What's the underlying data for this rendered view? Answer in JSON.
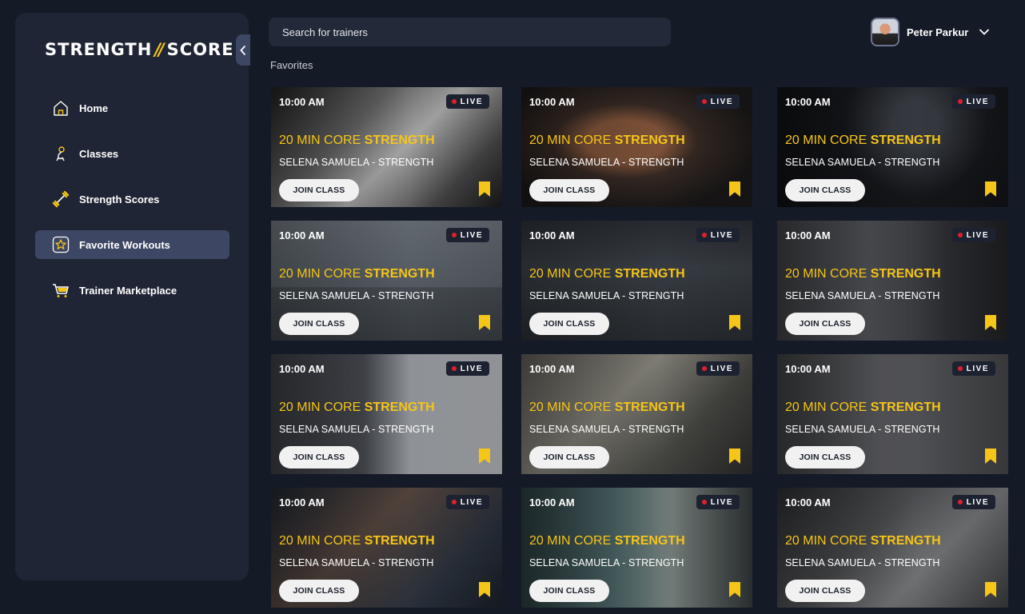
{
  "app": {
    "logo_left": "STRENGTH",
    "logo_slash": "//",
    "logo_right": "SCORE"
  },
  "sidebar": {
    "items": [
      {
        "label": "Home",
        "icon": "home-icon",
        "active": false
      },
      {
        "label": "Classes",
        "icon": "classes-icon",
        "active": false
      },
      {
        "label": "Strength Scores",
        "icon": "dumbbell-icon",
        "active": false
      },
      {
        "label": "Favorite Workouts",
        "icon": "star-icon",
        "active": true
      },
      {
        "label": "Trainer Marketplace",
        "icon": "cart-icon",
        "active": false
      }
    ]
  },
  "header": {
    "search_placeholder": "Search for trainers",
    "user_name": "Peter Parkur"
  },
  "main": {
    "section_title": "Favorites",
    "cards": [
      {
        "time": "10:00 AM",
        "live": "LIVE",
        "title_plain": "20 MIN CORE ",
        "title_bold": "STRENGTH",
        "subtitle": "SELENA SAMUELA - STRENGTH",
        "join_label": "JOIN CLASS"
      },
      {
        "time": "10:00 AM",
        "live": "LIVE",
        "title_plain": "20 MIN CORE ",
        "title_bold": "STRENGTH",
        "subtitle": "SELENA SAMUELA - STRENGTH",
        "join_label": "JOIN CLASS"
      },
      {
        "time": "10:00 AM",
        "live": "LIVE",
        "title_plain": "20 MIN CORE ",
        "title_bold": "STRENGTH",
        "subtitle": "SELENA SAMUELA - STRENGTH",
        "join_label": "JOIN CLASS"
      },
      {
        "time": "10:00 AM",
        "live": "LIVE",
        "title_plain": "20 MIN CORE ",
        "title_bold": "STRENGTH",
        "subtitle": "SELENA SAMUELA - STRENGTH",
        "join_label": "JOIN CLASS"
      },
      {
        "time": "10:00 AM",
        "live": "LIVE",
        "title_plain": "20 MIN CORE ",
        "title_bold": "STRENGTH",
        "subtitle": "SELENA SAMUELA - STRENGTH",
        "join_label": "JOIN CLASS"
      },
      {
        "time": "10:00 AM",
        "live": "LIVE",
        "title_plain": "20 MIN CORE ",
        "title_bold": "STRENGTH",
        "subtitle": "SELENA SAMUELA - STRENGTH",
        "join_label": "JOIN CLASS"
      },
      {
        "time": "10:00 AM",
        "live": "LIVE",
        "title_plain": "20 MIN CORE ",
        "title_bold": "STRENGTH",
        "subtitle": "SELENA SAMUELA - STRENGTH",
        "join_label": "JOIN CLASS"
      },
      {
        "time": "10:00 AM",
        "live": "LIVE",
        "title_plain": "20 MIN CORE ",
        "title_bold": "STRENGTH",
        "subtitle": "SELENA SAMUELA - STRENGTH",
        "join_label": "JOIN CLASS"
      },
      {
        "time": "10:00 AM",
        "live": "LIVE",
        "title_plain": "20 MIN CORE ",
        "title_bold": "STRENGTH",
        "subtitle": "SELENA SAMUELA - STRENGTH",
        "join_label": "JOIN CLASS"
      },
      {
        "time": "10:00 AM",
        "live": "LIVE",
        "title_plain": "20 MIN CORE ",
        "title_bold": "STRENGTH",
        "subtitle": "SELENA SAMUELA - STRENGTH",
        "join_label": "JOIN CLASS"
      },
      {
        "time": "10:00 AM",
        "live": "LIVE",
        "title_plain": "20 MIN CORE ",
        "title_bold": "STRENGTH",
        "subtitle": "SELENA SAMUELA - STRENGTH",
        "join_label": "JOIN CLASS"
      },
      {
        "time": "10:00 AM",
        "live": "LIVE",
        "title_plain": "20 MIN CORE ",
        "title_bold": "STRENGTH",
        "subtitle": "SELENA SAMUELA - STRENGTH",
        "join_label": "JOIN CLASS"
      }
    ]
  },
  "colors": {
    "accent": "#f5c518",
    "live_dot": "#e0202a",
    "sidebar_bg": "#1f2534",
    "page_bg": "#141b26",
    "active_item": "#3d4663"
  }
}
